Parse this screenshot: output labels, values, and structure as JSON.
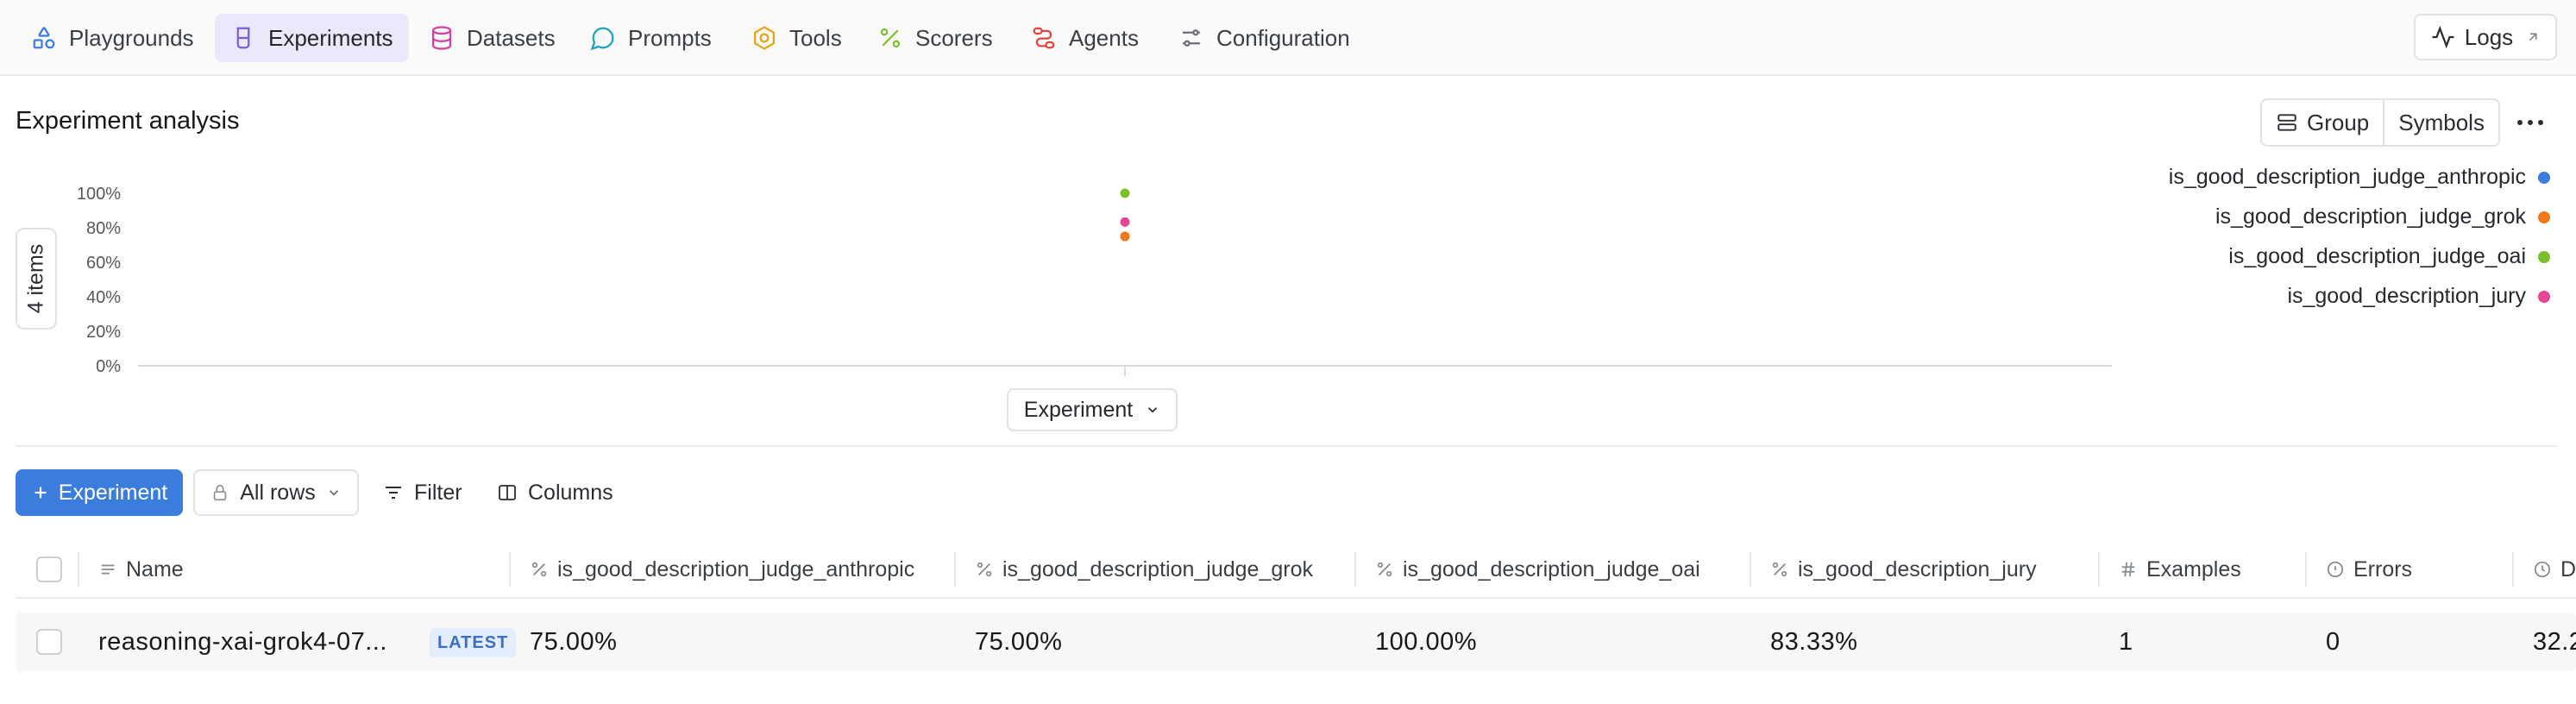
{
  "nav": {
    "items": [
      {
        "label": "Playgrounds",
        "icon": "shapes-icon",
        "color": "#3b7ddd"
      },
      {
        "label": "Experiments",
        "icon": "beaker-icon",
        "color": "#7c5cd6"
      },
      {
        "label": "Datasets",
        "icon": "database-icon",
        "color": "#d63fa0"
      },
      {
        "label": "Prompts",
        "icon": "chat-bubble-icon",
        "color": "#1aa6b7"
      },
      {
        "label": "Tools",
        "icon": "hexagon-icon",
        "color": "#e8a317"
      },
      {
        "label": "Scorers",
        "icon": "percent-icon",
        "color": "#7bbf2a"
      },
      {
        "label": "Agents",
        "icon": "route-icon",
        "color": "#e0453a"
      },
      {
        "label": "Configuration",
        "icon": "sliders-icon",
        "color": "#6b7077"
      }
    ],
    "active": "Experiments",
    "logs_label": "Logs"
  },
  "analysis": {
    "title": "Experiment analysis",
    "group_label": "Group",
    "symbols_label": "Symbols",
    "items_count_label": "4 items",
    "x_axis_selector": "Experiment"
  },
  "chart_data": {
    "type": "scatter",
    "y_ticks": [
      "0%",
      "20%",
      "40%",
      "60%",
      "80%",
      "100%"
    ],
    "ylim": [
      0,
      100
    ],
    "grid": false,
    "legend_position": "top-right",
    "categories": [
      "reasoning-xai-grok4-07..."
    ],
    "series": [
      {
        "name": "is_good_description_judge_anthropic",
        "color": "#3b7ddd",
        "values": [
          75
        ]
      },
      {
        "name": "is_good_description_judge_grok",
        "color": "#f07a1a",
        "values": [
          75
        ]
      },
      {
        "name": "is_good_description_judge_oai",
        "color": "#7bbf2a",
        "values": [
          100
        ]
      },
      {
        "name": "is_good_description_jury",
        "color": "#e64595",
        "values": [
          83.33
        ]
      }
    ]
  },
  "toolbar": {
    "add_experiment_label": "Experiment",
    "rows_filter_label": "All rows",
    "filter_label": "Filter",
    "columns_label": "Columns"
  },
  "table": {
    "headers": {
      "name": "Name",
      "anthropic": "is_good_description_judge_anthropic",
      "grok": "is_good_description_judge_grok",
      "oai": "is_good_description_judge_oai",
      "jury": "is_good_description_jury",
      "examples": "Examples",
      "errors": "Errors",
      "duration": "D"
    },
    "rows": [
      {
        "name": "reasoning-xai-grok4-07...",
        "badge": "LATEST",
        "anthropic": "75.00%",
        "grok": "75.00%",
        "oai": "100.00%",
        "jury": "83.33%",
        "examples": "1",
        "errors": "0",
        "duration": "32.2"
      }
    ]
  }
}
